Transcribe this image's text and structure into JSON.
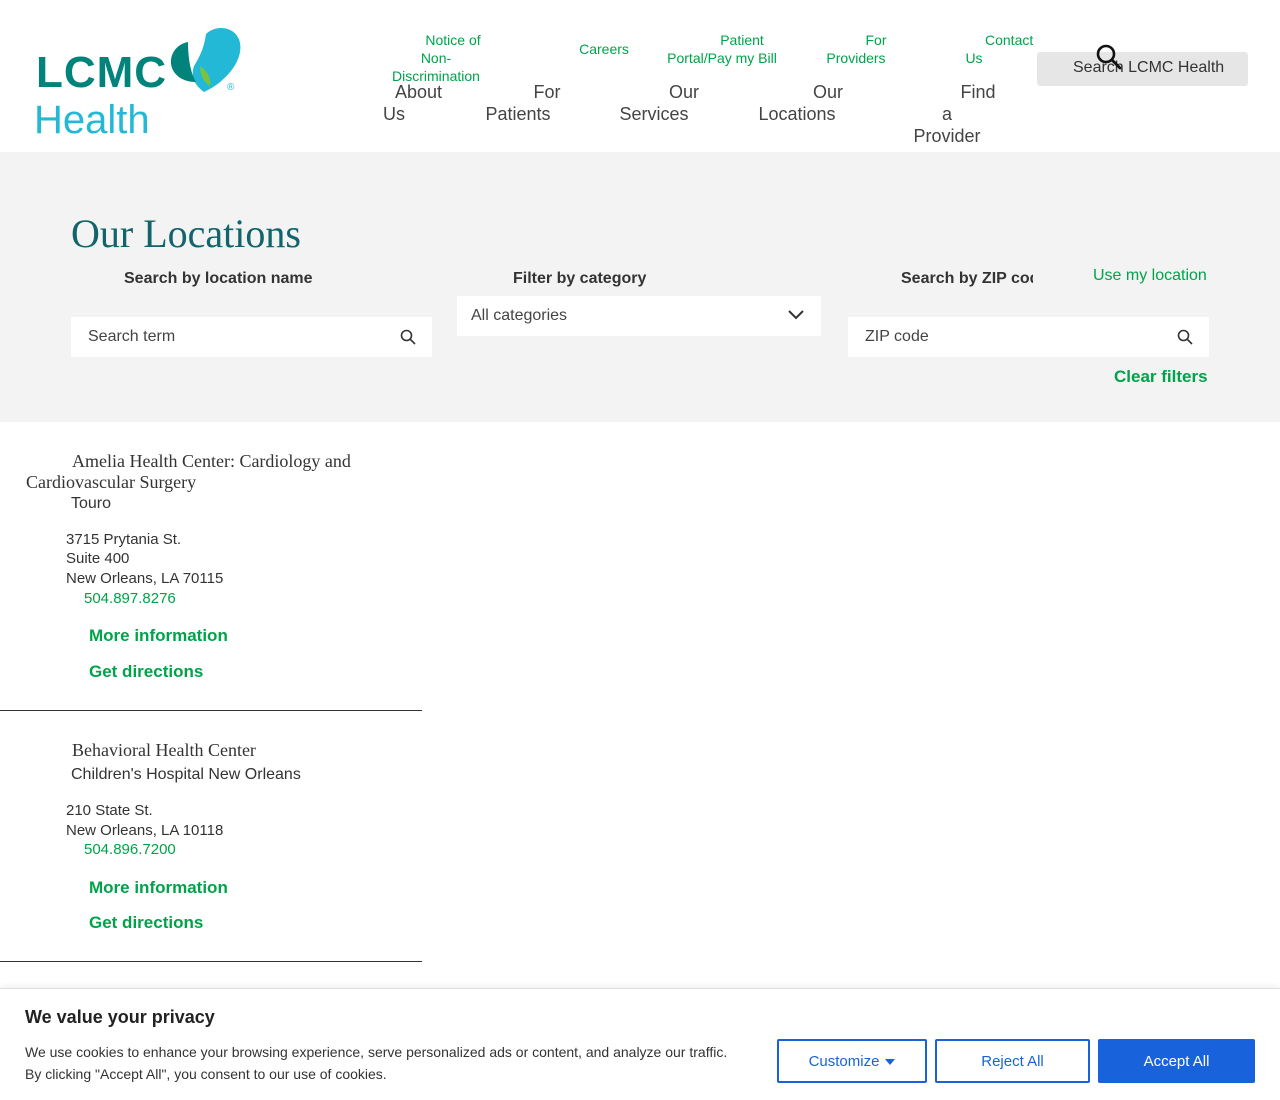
{
  "brand": {
    "logo_top": "LCMC",
    "logo_bottom": "Health",
    "reg_mark": "®"
  },
  "utility_nav": [
    {
      "label_line1": "Notice of Non-",
      "label_line2": "Discrimination"
    },
    {
      "label_line1": "Careers",
      "label_line2": ""
    },
    {
      "label_line1": "Patient",
      "label_line2": "Portal/Pay my Bill"
    },
    {
      "label_line1": "For",
      "label_line2": "Providers"
    },
    {
      "label_line1": "Contact",
      "label_line2": "Us"
    }
  ],
  "main_nav": [
    {
      "label_line1": "About",
      "label_line2": "Us"
    },
    {
      "label_line1": "For",
      "label_line2": "Patients"
    },
    {
      "label_line1": "Our",
      "label_line2": "Services"
    },
    {
      "label_line1": "Our",
      "label_line2": "Locations"
    },
    {
      "label_line1": "Find a",
      "label_line2": "Provider"
    }
  ],
  "search": {
    "placeholder": "Search LCMC Health"
  },
  "page": {
    "title": "Our Locations"
  },
  "filters": {
    "name_label": "Search by location name",
    "name_placeholder": "Search term",
    "category_label": "Filter by category",
    "category_value": "All categories",
    "zip_label": "Search by ZIP code",
    "zip_placeholder": "ZIP code",
    "use_location": "Use my location",
    "clear": "Clear filters"
  },
  "locations": [
    {
      "name": "Amelia Health Center: Cardiology and Cardiovascular Surgery",
      "campus": "Touro",
      "address": [
        "3715 Prytania St.",
        "Suite 400",
        "New Orleans, LA 70115"
      ],
      "phone": "504.897.8276",
      "more": "More information",
      "directions": "Get directions"
    },
    {
      "name": "Behavioral Health Center",
      "campus": "Children's Hospital New Orleans",
      "address": [
        "210 State St.",
        "New Orleans, LA 10118"
      ],
      "phone": "504.896.7200",
      "more": "More information",
      "directions": "Get directions"
    }
  ],
  "cookie": {
    "title": "We value your privacy",
    "text_line1": "We use cookies to enhance your browsing experience, serve personalized ads or content, and analyze our traffic.",
    "text_line2": "By clicking \"Accept All\", you consent to our use of cookies.",
    "customize": "Customize",
    "reject": "Reject All",
    "accept": "Accept All"
  },
  "colors": {
    "brand_teal": "#00837a",
    "brand_cyan": "#23b9d6",
    "link_green": "#00a34a",
    "title_teal": "#12636a",
    "cookie_blue": "#1863dc"
  }
}
